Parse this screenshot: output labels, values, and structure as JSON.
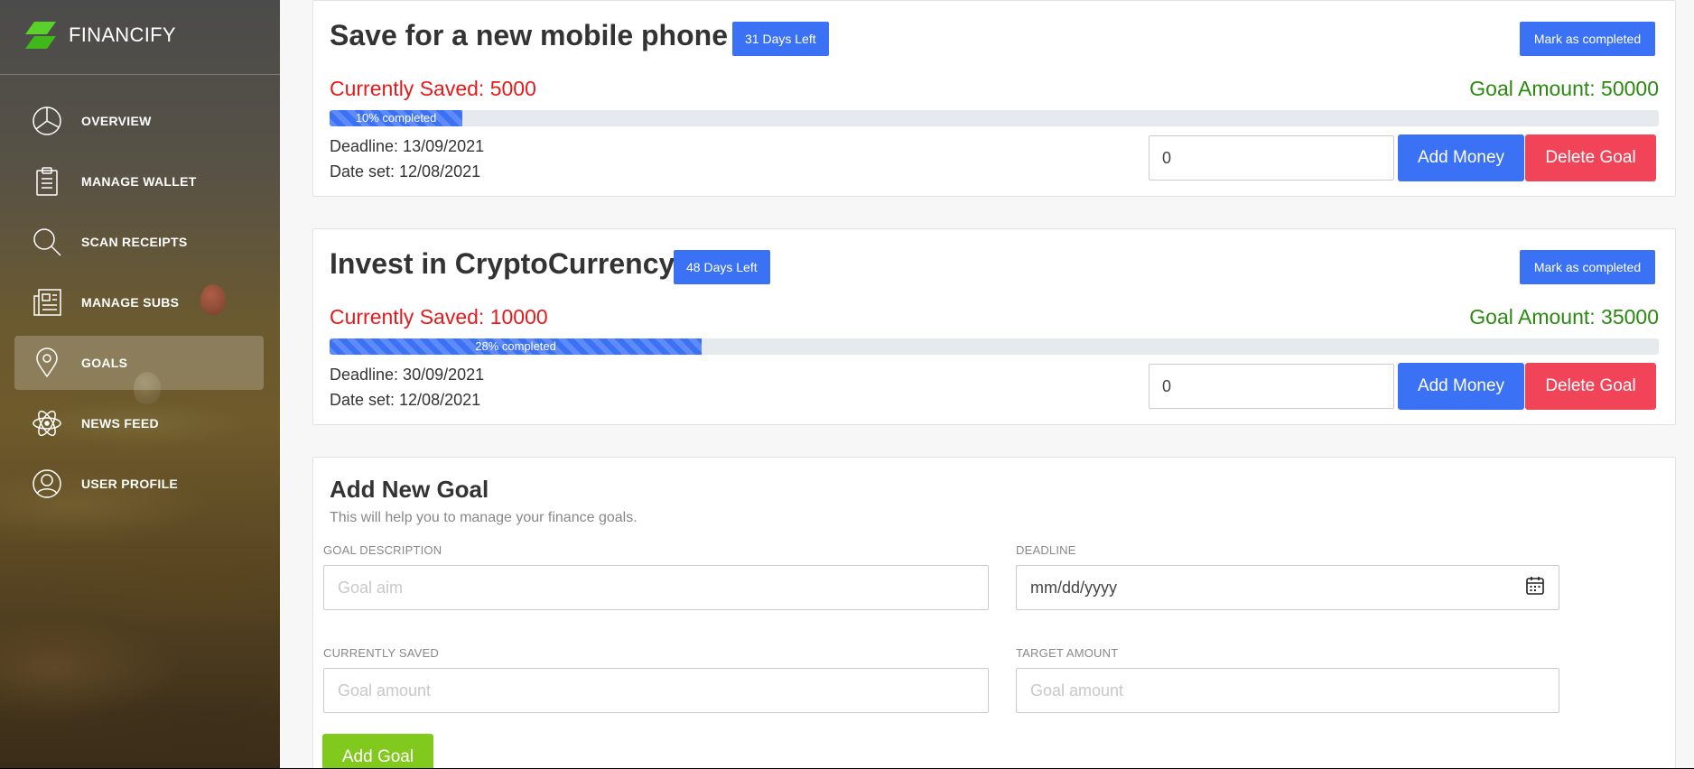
{
  "brand": {
    "name": "FINANCIFY"
  },
  "sidebar": {
    "items": [
      {
        "label": "OVERVIEW",
        "icon": "pie-chart-icon"
      },
      {
        "label": "MANAGE WALLET",
        "icon": "clipboard-icon"
      },
      {
        "label": "SCAN RECEIPTS",
        "icon": "search-icon"
      },
      {
        "label": "MANAGE SUBS",
        "icon": "newspaper-icon"
      },
      {
        "label": "GOALS",
        "icon": "map-pin-icon",
        "active": true
      },
      {
        "label": "NEWS FEED",
        "icon": "atom-icon"
      },
      {
        "label": "USER PROFILE",
        "icon": "user-icon"
      }
    ]
  },
  "goals": [
    {
      "title": "Save for a new mobile phone",
      "days_left": "31 Days Left",
      "mark_label": "Mark as completed",
      "saved_text": "Currently Saved: 5000",
      "goal_text": "Goal Amount: 50000",
      "progress_fraction": 0.1,
      "progress_text": "10% completed",
      "deadline_text": "Deadline: 13/09/2021",
      "date_set_text": "Date set: 12/08/2021",
      "amount_value": "0",
      "add_money_label": "Add Money",
      "delete_label": "Delete Goal"
    },
    {
      "title": "Invest in CryptoCurrency",
      "days_left": "48 Days Left",
      "mark_label": "Mark as completed",
      "saved_text": "Currently Saved: 10000",
      "goal_text": "Goal Amount: 35000",
      "progress_fraction": 0.28,
      "progress_text": "28% completed",
      "deadline_text": "Deadline: 30/09/2021",
      "date_set_text": "Date set: 12/08/2021",
      "amount_value": "0",
      "add_money_label": "Add Money",
      "delete_label": "Delete Goal"
    }
  ],
  "form": {
    "title": "Add New Goal",
    "subtitle": "This will help you to manage your finance goals.",
    "description_label": "GOAL DESCRIPTION",
    "description_placeholder": "Goal aim",
    "deadline_label": "DEADLINE",
    "deadline_placeholder": "mm/dd/yyyy",
    "saved_label": "CURRENTLY SAVED",
    "saved_placeholder": "Goal amount",
    "target_label": "TARGET AMOUNT",
    "target_placeholder": "Goal amount",
    "submit_label": "Add Goal"
  },
  "colors": {
    "primary": "#3b72f5",
    "danger": "#f24458",
    "success": "#82c91e",
    "saved_text": "#e61a1a",
    "goal_text": "#2a8a10"
  }
}
